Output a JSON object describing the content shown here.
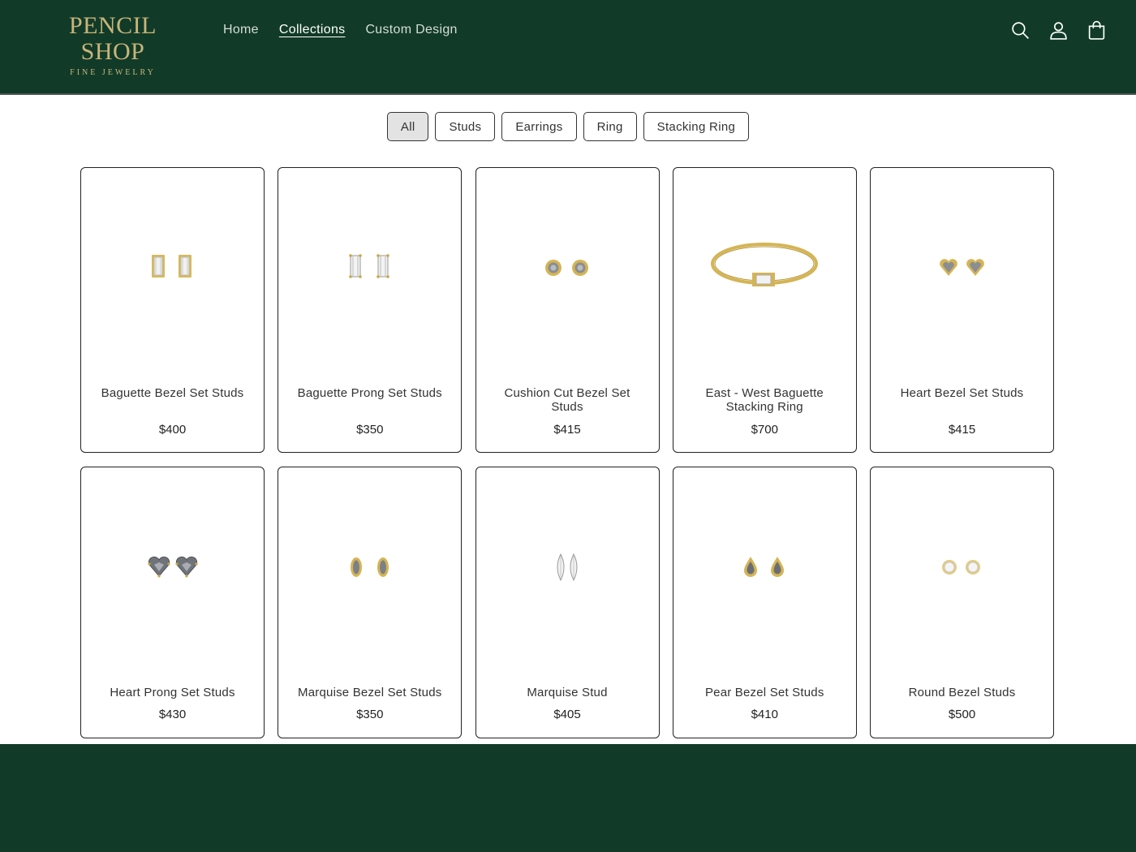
{
  "brand": {
    "title": "PENCIL SHOP",
    "subtitle": "FINE JEWELRY"
  },
  "nav": [
    {
      "label": "Home",
      "active": false
    },
    {
      "label": "Collections",
      "active": true
    },
    {
      "label": "Custom Design",
      "active": false
    }
  ],
  "header_icons": [
    "search-icon",
    "account-icon",
    "cart-icon"
  ],
  "filters": [
    {
      "label": "All",
      "active": true
    },
    {
      "label": "Studs",
      "active": false
    },
    {
      "label": "Earrings",
      "active": false
    },
    {
      "label": "Ring",
      "active": false
    },
    {
      "label": "Stacking Ring",
      "active": false
    }
  ],
  "products": [
    {
      "name": "Baguette Bezel Set Studs",
      "price": "$400",
      "image": "baguette-bezel"
    },
    {
      "name": "Baguette Prong Set Studs",
      "price": "$350",
      "image": "baguette-prong"
    },
    {
      "name": "Cushion Cut Bezel Set Studs",
      "price": "$415",
      "image": "cushion-bezel"
    },
    {
      "name": "East - West Baguette Stacking Ring",
      "price": "$700",
      "image": "ring"
    },
    {
      "name": "Heart Bezel Set Studs",
      "price": "$415",
      "image": "heart-bezel"
    },
    {
      "name": "Heart Prong Set Studs",
      "price": "$430",
      "image": "heart-prong"
    },
    {
      "name": "Marquise Bezel Set Studs",
      "price": "$350",
      "image": "marquise-bezel"
    },
    {
      "name": "Marquise Stud",
      "price": "$405",
      "image": "marquise-stud"
    },
    {
      "name": "Pear Bezel Set Studs",
      "price": "$410",
      "image": "pear-bezel"
    },
    {
      "name": "Round Bezel Studs",
      "price": "$500",
      "image": "round-bezel"
    }
  ],
  "colors": {
    "brand_green": "#113b28",
    "gold": "#d4b455",
    "logo_gold": "#c9b47a"
  }
}
